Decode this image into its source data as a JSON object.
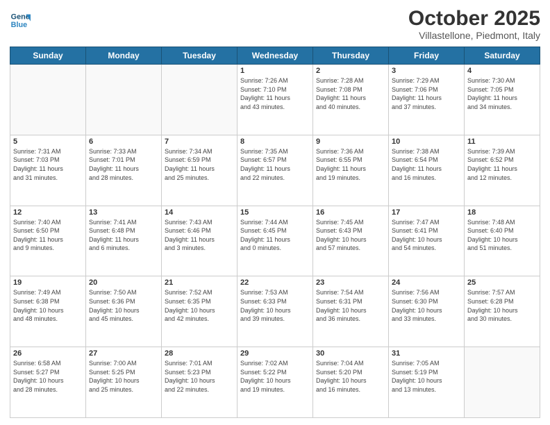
{
  "header": {
    "logo_line1": "General",
    "logo_line2": "Blue",
    "title": "October 2025",
    "location": "Villastellone, Piedmont, Italy"
  },
  "weekdays": [
    "Sunday",
    "Monday",
    "Tuesday",
    "Wednesday",
    "Thursday",
    "Friday",
    "Saturday"
  ],
  "weeks": [
    [
      {
        "num": "",
        "info": ""
      },
      {
        "num": "",
        "info": ""
      },
      {
        "num": "",
        "info": ""
      },
      {
        "num": "1",
        "info": "Sunrise: 7:26 AM\nSunset: 7:10 PM\nDaylight: 11 hours\nand 43 minutes."
      },
      {
        "num": "2",
        "info": "Sunrise: 7:28 AM\nSunset: 7:08 PM\nDaylight: 11 hours\nand 40 minutes."
      },
      {
        "num": "3",
        "info": "Sunrise: 7:29 AM\nSunset: 7:06 PM\nDaylight: 11 hours\nand 37 minutes."
      },
      {
        "num": "4",
        "info": "Sunrise: 7:30 AM\nSunset: 7:05 PM\nDaylight: 11 hours\nand 34 minutes."
      }
    ],
    [
      {
        "num": "5",
        "info": "Sunrise: 7:31 AM\nSunset: 7:03 PM\nDaylight: 11 hours\nand 31 minutes."
      },
      {
        "num": "6",
        "info": "Sunrise: 7:33 AM\nSunset: 7:01 PM\nDaylight: 11 hours\nand 28 minutes."
      },
      {
        "num": "7",
        "info": "Sunrise: 7:34 AM\nSunset: 6:59 PM\nDaylight: 11 hours\nand 25 minutes."
      },
      {
        "num": "8",
        "info": "Sunrise: 7:35 AM\nSunset: 6:57 PM\nDaylight: 11 hours\nand 22 minutes."
      },
      {
        "num": "9",
        "info": "Sunrise: 7:36 AM\nSunset: 6:55 PM\nDaylight: 11 hours\nand 19 minutes."
      },
      {
        "num": "10",
        "info": "Sunrise: 7:38 AM\nSunset: 6:54 PM\nDaylight: 11 hours\nand 16 minutes."
      },
      {
        "num": "11",
        "info": "Sunrise: 7:39 AM\nSunset: 6:52 PM\nDaylight: 11 hours\nand 12 minutes."
      }
    ],
    [
      {
        "num": "12",
        "info": "Sunrise: 7:40 AM\nSunset: 6:50 PM\nDaylight: 11 hours\nand 9 minutes."
      },
      {
        "num": "13",
        "info": "Sunrise: 7:41 AM\nSunset: 6:48 PM\nDaylight: 11 hours\nand 6 minutes."
      },
      {
        "num": "14",
        "info": "Sunrise: 7:43 AM\nSunset: 6:46 PM\nDaylight: 11 hours\nand 3 minutes."
      },
      {
        "num": "15",
        "info": "Sunrise: 7:44 AM\nSunset: 6:45 PM\nDaylight: 11 hours\nand 0 minutes."
      },
      {
        "num": "16",
        "info": "Sunrise: 7:45 AM\nSunset: 6:43 PM\nDaylight: 10 hours\nand 57 minutes."
      },
      {
        "num": "17",
        "info": "Sunrise: 7:47 AM\nSunset: 6:41 PM\nDaylight: 10 hours\nand 54 minutes."
      },
      {
        "num": "18",
        "info": "Sunrise: 7:48 AM\nSunset: 6:40 PM\nDaylight: 10 hours\nand 51 minutes."
      }
    ],
    [
      {
        "num": "19",
        "info": "Sunrise: 7:49 AM\nSunset: 6:38 PM\nDaylight: 10 hours\nand 48 minutes."
      },
      {
        "num": "20",
        "info": "Sunrise: 7:50 AM\nSunset: 6:36 PM\nDaylight: 10 hours\nand 45 minutes."
      },
      {
        "num": "21",
        "info": "Sunrise: 7:52 AM\nSunset: 6:35 PM\nDaylight: 10 hours\nand 42 minutes."
      },
      {
        "num": "22",
        "info": "Sunrise: 7:53 AM\nSunset: 6:33 PM\nDaylight: 10 hours\nand 39 minutes."
      },
      {
        "num": "23",
        "info": "Sunrise: 7:54 AM\nSunset: 6:31 PM\nDaylight: 10 hours\nand 36 minutes."
      },
      {
        "num": "24",
        "info": "Sunrise: 7:56 AM\nSunset: 6:30 PM\nDaylight: 10 hours\nand 33 minutes."
      },
      {
        "num": "25",
        "info": "Sunrise: 7:57 AM\nSunset: 6:28 PM\nDaylight: 10 hours\nand 30 minutes."
      }
    ],
    [
      {
        "num": "26",
        "info": "Sunrise: 6:58 AM\nSunset: 5:27 PM\nDaylight: 10 hours\nand 28 minutes."
      },
      {
        "num": "27",
        "info": "Sunrise: 7:00 AM\nSunset: 5:25 PM\nDaylight: 10 hours\nand 25 minutes."
      },
      {
        "num": "28",
        "info": "Sunrise: 7:01 AM\nSunset: 5:23 PM\nDaylight: 10 hours\nand 22 minutes."
      },
      {
        "num": "29",
        "info": "Sunrise: 7:02 AM\nSunset: 5:22 PM\nDaylight: 10 hours\nand 19 minutes."
      },
      {
        "num": "30",
        "info": "Sunrise: 7:04 AM\nSunset: 5:20 PM\nDaylight: 10 hours\nand 16 minutes."
      },
      {
        "num": "31",
        "info": "Sunrise: 7:05 AM\nSunset: 5:19 PM\nDaylight: 10 hours\nand 13 minutes."
      },
      {
        "num": "",
        "info": ""
      }
    ]
  ]
}
